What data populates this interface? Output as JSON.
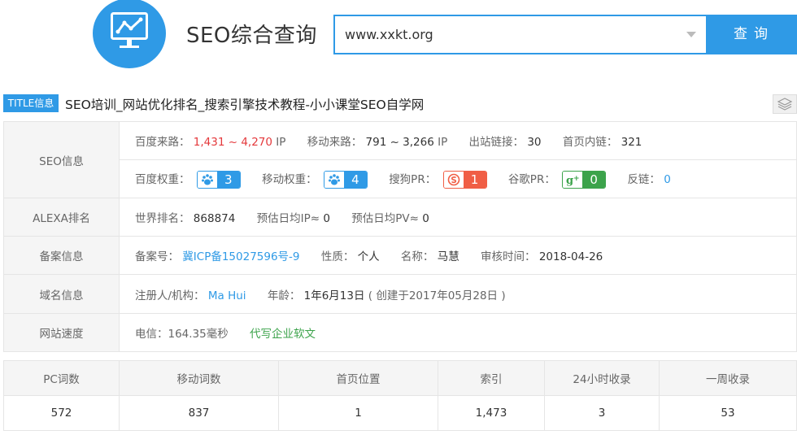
{
  "header": {
    "site_title": "SEO综合查询",
    "search_value": "www.xxkt.org",
    "search_button": "查询"
  },
  "title_row": {
    "badge": "TITLE信息",
    "text": "SEO培训_网站优化排名_搜索引擎技术教程-小小课堂SEO自学网"
  },
  "seo_info": {
    "label": "SEO信息",
    "baidu_traffic_label": "百度来路：",
    "baidu_traffic_value": "1,431 ~ 4,270",
    "baidu_traffic_unit": "IP",
    "mobile_traffic_label": "移动来路：",
    "mobile_traffic_value": "791 ~ 3,266",
    "mobile_traffic_unit": "IP",
    "outlinks_label": "出站链接：",
    "outlinks_value": "30",
    "homepage_links_label": "首页内链：",
    "homepage_links_value": "321",
    "baidu_weight_label": "百度权重：",
    "baidu_weight_value": "3",
    "mobile_weight_label": "移动权重：",
    "mobile_weight_value": "4",
    "sogou_pr_label": "搜狗PR：",
    "sogou_pr_value": "1",
    "google_pr_label": "谷歌PR：",
    "google_pr_value": "0",
    "backlinks_label": "反链：",
    "backlinks_value": "0"
  },
  "alexa": {
    "label": "ALEXA排名",
    "world_rank_label": "世界排名：",
    "world_rank_value": "868874",
    "ip_label": "预估日均IP≈",
    "ip_value": "0",
    "pv_label": "预估日均PV≈",
    "pv_value": "0"
  },
  "icp": {
    "label": "备案信息",
    "number_label": "备案号：",
    "number_value": "冀ICP备15027596号-9",
    "nature_label": "性质：",
    "nature_value": "个人",
    "name_label": "名称：",
    "name_value": "马慧",
    "review_label": "审核时间：",
    "review_value": "2018-04-26"
  },
  "domain": {
    "label": "域名信息",
    "registrant_label": "注册人/机构：",
    "registrant_value": "Ma Hui",
    "age_label": "年龄：",
    "age_value": "1年6月13日",
    "created": "( 创建于2017年05月28日 )"
  },
  "speed": {
    "label": "网站速度",
    "telecom": "电信：164.35毫秒",
    "ad_link": "代写企业软文"
  },
  "stats": {
    "headers": [
      "PC词数",
      "移动词数",
      "首页位置",
      "索引",
      "24小时收录",
      "一周收录"
    ],
    "values": [
      "572",
      "837",
      "1",
      "1,473",
      "3",
      "53"
    ]
  },
  "colors": {
    "accent": "#2f9ae6",
    "red": "#e4393c",
    "sogou": "#f05e45",
    "google": "#3ca34b"
  },
  "icons": [
    "chart-logo-icon",
    "chevron-down-icon",
    "layers-icon",
    "paw-icon",
    "sogou-icon",
    "google-plus-icon"
  ]
}
